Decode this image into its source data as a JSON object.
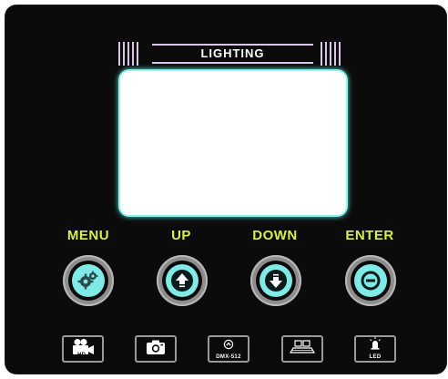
{
  "header": {
    "title": "LIGHTING"
  },
  "colors": {
    "panel": "#0b0b0c",
    "accent_label": "#d8f04a",
    "button_core": "#7feae6",
    "screen_glow": "#8ff3ee",
    "header_lines": "#d8c6e6"
  },
  "buttons": [
    {
      "label": "MENU",
      "icon": "gear-icon"
    },
    {
      "label": "UP",
      "icon": "arrow-up-icon"
    },
    {
      "label": "DOWN",
      "icon": "arrow-down-icon"
    },
    {
      "label": "ENTER",
      "icon": "enter-icon"
    }
  ],
  "mode_buttons": [
    {
      "icon": "hd-video-camera-icon",
      "label": "HD"
    },
    {
      "icon": "camera-icon",
      "label": ""
    },
    {
      "icon": "dmx-icon",
      "label": "DMX-512"
    },
    {
      "icon": "stage-icon",
      "label": ""
    },
    {
      "icon": "led-lamp-icon",
      "label": "LED"
    }
  ]
}
